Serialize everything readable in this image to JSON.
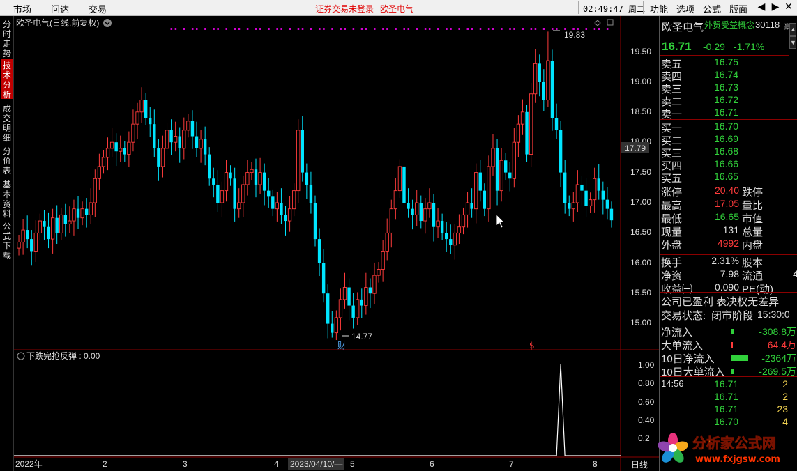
{
  "topbar": {
    "menus_left": [
      "市场",
      "问达",
      "交易"
    ],
    "status_warning": "证券交易未登录",
    "stock_name": "欧圣电气",
    "clock": "02:49:47 周二",
    "menus_right": [
      "功能",
      "选项",
      "公式",
      "版面"
    ],
    "controls": [
      "◀",
      "▶",
      "✕"
    ]
  },
  "left_tabs": [
    {
      "label": "分时走势",
      "active": false
    },
    {
      "label": "技术分析",
      "active": true
    },
    {
      "label": "成交明细",
      "active": false
    },
    {
      "label": "分价表",
      "active": false
    },
    {
      "label": "基本资料",
      "active": false
    },
    {
      "label": "公式下载",
      "active": false
    }
  ],
  "chart": {
    "header": "欧圣电气(日线,前复权)",
    "price_axis": [
      "19.50",
      "19.00",
      "18.50",
      "18.00",
      "17.50",
      "17.00",
      "16.50",
      "16.00",
      "15.50",
      "15.00"
    ],
    "current_price_tag": "17.79",
    "high_label": "19.83",
    "low_label": "14.77",
    "event_markers": [
      "财",
      "$"
    ],
    "indicator_header": "下跌完抢反弹 : 0.00",
    "indicator_axis": [
      "1.00",
      "0.80",
      "0.60",
      "0.40",
      "0.2"
    ],
    "x_axis": [
      "2022年",
      "2",
      "3",
      "4",
      "2023/04/10/—",
      "5",
      "6",
      "7",
      "8"
    ],
    "period_label": "日线"
  },
  "chart_data": {
    "type": "candlestick",
    "title": "欧圣电气(日线,前复权)",
    "ylim": [
      14.6,
      20.0
    ],
    "x_ticks": [
      "2022年",
      "2",
      "3",
      "4",
      "5",
      "6",
      "7",
      "8"
    ],
    "annotated_high": 19.83,
    "annotated_low": 14.77,
    "last_close": 16.71,
    "closes": [
      16.35,
      16.55,
      16.4,
      16.2,
      16.5,
      16.7,
      16.6,
      16.4,
      16.75,
      16.5,
      16.8,
      16.65,
      16.7,
      16.9,
      16.75,
      16.9,
      16.8,
      17.0,
      17.4,
      17.6,
      17.75,
      17.9,
      18.0,
      17.85,
      17.9,
      17.8,
      18.0,
      18.3,
      18.5,
      18.7,
      18.4,
      18.3,
      17.9,
      17.6,
      17.9,
      18.2,
      18.0,
      18.1,
      17.9,
      18.2,
      18.35,
      18.1,
      17.9,
      18.05,
      17.8,
      17.4,
      17.3,
      17.0,
      17.2,
      17.5,
      17.4,
      16.9,
      17.0,
      17.3,
      17.5,
      17.55,
      17.3,
      17.5,
      17.2,
      17.1,
      16.9,
      17.0,
      16.8,
      16.7,
      16.9,
      17.2,
      18.2,
      17.5,
      17.3,
      17.0,
      16.4,
      16.0,
      15.5,
      15.0,
      14.85,
      15.1,
      15.4,
      15.6,
      15.3,
      15.1,
      15.4,
      15.3,
      15.6,
      15.5,
      15.8,
      15.9,
      16.2,
      16.5,
      16.9,
      17.2,
      17.6,
      17.0,
      16.9,
      16.8,
      17.0,
      16.7,
      16.9,
      17.0,
      16.6,
      16.7,
      16.5,
      16.4,
      16.3,
      16.5,
      16.6,
      16.8,
      17.0,
      16.9,
      17.5,
      17.2,
      16.9,
      17.6,
      17.9,
      17.2,
      17.7,
      17.5,
      17.4,
      18.0,
      18.3,
      18.5,
      17.8,
      18.8,
      19.3,
      19.0,
      18.7,
      19.35,
      18.4,
      18.2,
      17.5,
      17.0,
      16.9,
      17.0,
      17.3,
      17.2,
      16.95,
      17.05,
      17.4,
      17.2,
      17.05,
      16.9,
      16.71
    ],
    "indicator": {
      "name": "下跌完抢反弹",
      "spike_value": 1.0,
      "spike_index": 128,
      "ylim": [
        0,
        1.1
      ]
    }
  },
  "quote": {
    "name": "欧圣电气",
    "concept": "外贸受益概念",
    "code": "30118",
    "suffix": "豪",
    "price": "16.71",
    "change": "-0.29",
    "change_pct": "-1.71%",
    "asks": [
      {
        "label": "卖五",
        "price": "16.75"
      },
      {
        "label": "卖四",
        "price": "16.74"
      },
      {
        "label": "卖三",
        "price": "16.73"
      },
      {
        "label": "卖二",
        "price": "16.72"
      },
      {
        "label": "卖一",
        "price": "16.71"
      }
    ],
    "bids": [
      {
        "label": "买一",
        "price": "16.70"
      },
      {
        "label": "买二",
        "price": "16.69"
      },
      {
        "label": "买三",
        "price": "16.68"
      },
      {
        "label": "买四",
        "price": "16.66"
      },
      {
        "label": "买五",
        "price": "16.65"
      }
    ],
    "stats": [
      {
        "label": "涨停",
        "value": "20.40",
        "tone": "up",
        "label2": "跌停"
      },
      {
        "label": "最高",
        "value": "17.05",
        "tone": "up",
        "label2": "量比"
      },
      {
        "label": "最低",
        "value": "16.65",
        "tone": "dn",
        "label2": "市值"
      },
      {
        "label": "现量",
        "value": "131",
        "tone": "lbl",
        "label2": "总量"
      },
      {
        "label": "外盘",
        "value": "4992",
        "tone": "up",
        "label2": "内盘"
      }
    ],
    "stats2": [
      {
        "label": "换手",
        "value": "2.31%",
        "label2": "股本"
      },
      {
        "label": "净资",
        "value": "7.98",
        "label2": "流通"
      },
      {
        "label": "收益㈠",
        "value": "0.090",
        "label2": "PE(动)"
      }
    ],
    "clipped_char": "4",
    "notice": "公司已盈利 表决权无差异",
    "trade_state_label": "交易状态:",
    "trade_state": "闭市阶段",
    "trade_time": "15:30:0",
    "flows": [
      {
        "label": "净流入",
        "value": "-308.8万",
        "tone": "dn"
      },
      {
        "label": "大单流入",
        "value": "64.4万",
        "tone": "up"
      },
      {
        "label": "10日净流入",
        "value": "-2364万",
        "tone": "dn"
      },
      {
        "label": "10日大单流入",
        "value": "-269.5万",
        "tone": "dn"
      }
    ],
    "ticks": [
      {
        "time": "14:56",
        "price": "16.71",
        "vol": "2"
      },
      {
        "time": "",
        "price": "16.71",
        "vol": "2"
      },
      {
        "time": "",
        "price": "16.71",
        "vol": "23"
      },
      {
        "time": "",
        "price": "16.70",
        "vol": "4"
      }
    ]
  },
  "watermark": {
    "title": "分析家公式网",
    "url": "www.fxjgsw.com"
  },
  "colors": {
    "up": "#ff3b3b",
    "down": "#00e5ff",
    "bg": "#000000",
    "accent": "#c00000",
    "marker": "#d000d0"
  }
}
